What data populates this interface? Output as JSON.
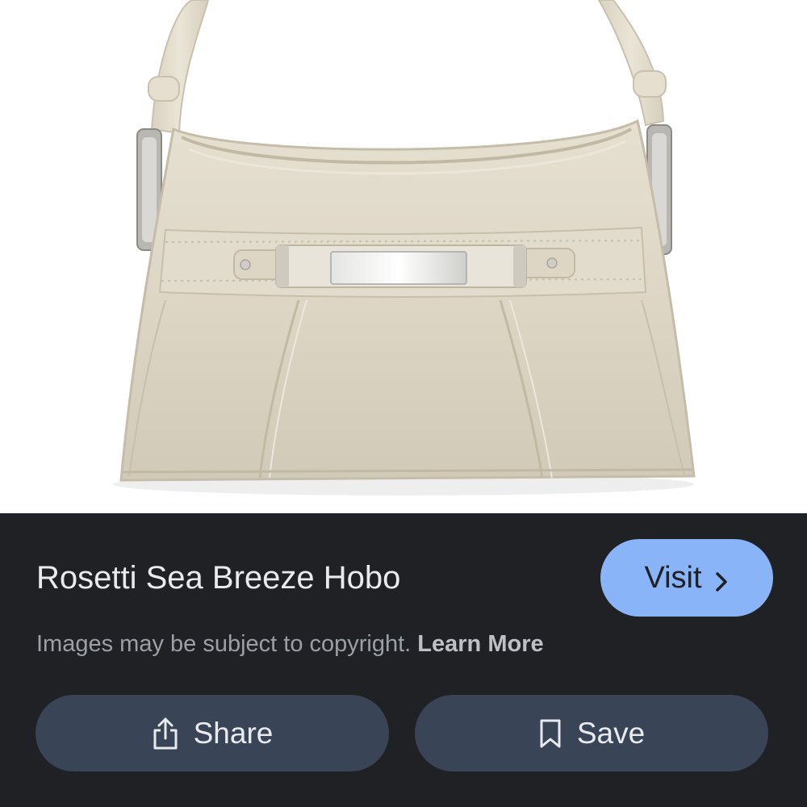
{
  "product": {
    "title": "Rosetti Sea Breeze Hobo",
    "image_subject": "beige-hobo-handbag"
  },
  "visit_button": {
    "label": "Visit",
    "icon": "chevron-right-icon"
  },
  "notice": {
    "text": "Images may be subject to copyright.",
    "link_label": "Learn More"
  },
  "actions": {
    "share_label": "Share",
    "share_icon": "share-icon",
    "save_label": "Save",
    "save_icon": "bookmark-icon"
  },
  "colors": {
    "panel_background": "#202124",
    "visit_button": "#8ab4f8",
    "action_button": "#394457",
    "bag": "#ddd6c6"
  }
}
